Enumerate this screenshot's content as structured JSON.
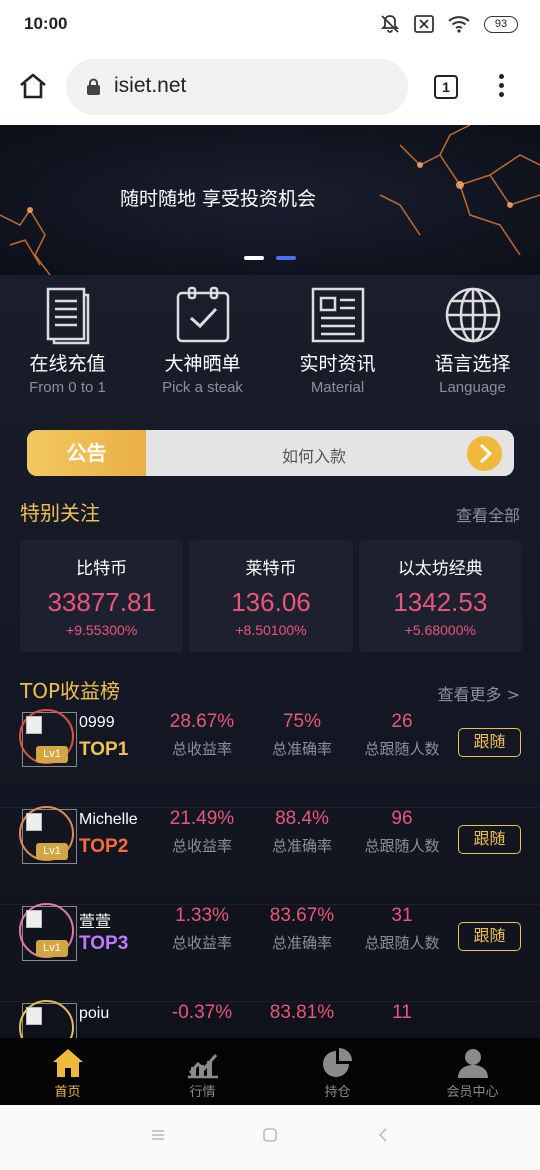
{
  "status_bar": {
    "time": "10:00",
    "battery": "93"
  },
  "browser": {
    "url": "isiet.net",
    "tab_count": "1"
  },
  "banner": {
    "text": "随时随地 享受投资机会",
    "active_dot_color": "#4a6ff0"
  },
  "features": [
    {
      "title": "在线充值",
      "subtitle": "From 0 to 1",
      "icon": "document-icon"
    },
    {
      "title": "大神晒单",
      "subtitle": "Pick a steak",
      "icon": "clipboard-check-icon"
    },
    {
      "title": "实时资讯",
      "subtitle": "Material",
      "icon": "newspaper-icon"
    },
    {
      "title": "语言选择",
      "subtitle": "Language",
      "icon": "globe-icon"
    }
  ],
  "notice": {
    "label": "公告",
    "text": "如何入款"
  },
  "special": {
    "title": "特别关注",
    "more": "查看全部",
    "coins": [
      {
        "name": "比特币",
        "price": "33877.81",
        "change": "+9.55300%"
      },
      {
        "name": "莱特币",
        "price": "136.06",
        "change": "+8.50100%"
      },
      {
        "name": "以太坊经典",
        "price": "1342.53",
        "change": "+5.68000%"
      }
    ]
  },
  "top": {
    "title": "TOP收益榜",
    "more": "查看更多 >",
    "stat_labels": [
      "总收益率",
      "总准确率",
      "总跟随人数"
    ],
    "follow_label": "跟随",
    "level_label": "Lv1",
    "rows": [
      {
        "name": "0999",
        "rank": "TOP1",
        "rank_color": "#f0c050",
        "ring_color": "#e0503a",
        "profit": "28.67%",
        "accuracy": "75%",
        "followers": "26"
      },
      {
        "name": "Michelle",
        "rank": "TOP2",
        "rank_color": "#ff6a3d",
        "ring_color": "#e08a50",
        "profit": "21.49%",
        "accuracy": "88.4%",
        "followers": "96"
      },
      {
        "name": "萱萱",
        "rank": "TOP3",
        "rank_color": "#c07aff",
        "ring_color": "#e07aa0",
        "profit": "1.33%",
        "accuracy": "83.67%",
        "followers": "31"
      },
      {
        "name": "poiu",
        "rank": "",
        "rank_color": "#f0c050",
        "ring_color": "#e0c050",
        "profit": "-0.37%",
        "accuracy": "83.81%",
        "followers": "11"
      }
    ]
  },
  "bottom_nav": [
    {
      "label": "首页",
      "icon": "home-icon",
      "active": true
    },
    {
      "label": "行情",
      "icon": "chart-icon",
      "active": false
    },
    {
      "label": "持仓",
      "icon": "pie-chart-icon",
      "active": false
    },
    {
      "label": "会员中心",
      "icon": "user-icon",
      "active": false
    }
  ],
  "colors": {
    "accent": "#f0c050",
    "up": "#e8567a",
    "nav_active": "#f0b939",
    "nav_inactive": "#8a8a8a"
  }
}
